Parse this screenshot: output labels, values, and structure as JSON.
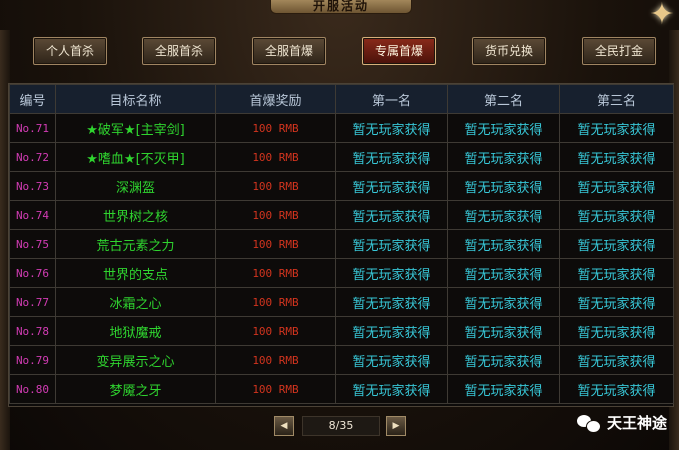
{
  "window_title": "开服活动",
  "tabs": [
    {
      "label": "个人首杀",
      "active": false
    },
    {
      "label": "全服首杀",
      "active": false
    },
    {
      "label": "全服首爆",
      "active": false
    },
    {
      "label": "专属首爆",
      "active": true
    },
    {
      "label": "货币兑换",
      "active": false
    },
    {
      "label": "全民打金",
      "active": false
    }
  ],
  "table": {
    "headers": [
      "编号",
      "目标名称",
      "首爆奖励",
      "第一名",
      "第二名",
      "第三名"
    ],
    "rows": [
      {
        "no": "No.71",
        "name": "★破军★[主宰剑]",
        "reward": "100 RMB",
        "first": "暂无玩家获得",
        "second": "暂无玩家获得",
        "third": "暂无玩家获得"
      },
      {
        "no": "No.72",
        "name": "★嗜血★[不灭甲]",
        "reward": "100 RMB",
        "first": "暂无玩家获得",
        "second": "暂无玩家获得",
        "third": "暂无玩家获得"
      },
      {
        "no": "No.73",
        "name": "深渊盔",
        "reward": "100 RMB",
        "first": "暂无玩家获得",
        "second": "暂无玩家获得",
        "third": "暂无玩家获得"
      },
      {
        "no": "No.74",
        "name": "世界树之核",
        "reward": "100 RMB",
        "first": "暂无玩家获得",
        "second": "暂无玩家获得",
        "third": "暂无玩家获得"
      },
      {
        "no": "No.75",
        "name": "荒古元素之力",
        "reward": "100 RMB",
        "first": "暂无玩家获得",
        "second": "暂无玩家获得",
        "third": "暂无玩家获得"
      },
      {
        "no": "No.76",
        "name": "世界的支点",
        "reward": "100 RMB",
        "first": "暂无玩家获得",
        "second": "暂无玩家获得",
        "third": "暂无玩家获得"
      },
      {
        "no": "No.77",
        "name": "冰霜之心",
        "reward": "100 RMB",
        "first": "暂无玩家获得",
        "second": "暂无玩家获得",
        "third": "暂无玩家获得"
      },
      {
        "no": "No.78",
        "name": "地狱魔戒",
        "reward": "100 RMB",
        "first": "暂无玩家获得",
        "second": "暂无玩家获得",
        "third": "暂无玩家获得"
      },
      {
        "no": "No.79",
        "name": "变异展示之心",
        "reward": "100 RMB",
        "first": "暂无玩家获得",
        "second": "暂无玩家获得",
        "third": "暂无玩家获得"
      },
      {
        "no": "No.80",
        "name": "梦魇之牙",
        "reward": "100 RMB",
        "first": "暂无玩家获得",
        "second": "暂无玩家获得",
        "third": "暂无玩家获得"
      }
    ]
  },
  "pager": {
    "text": "8/35",
    "prev_icon": "triangle-left-icon",
    "next_icon": "triangle-right-icon"
  },
  "watermark": {
    "text": "天王神途",
    "icon": "wechat-icon"
  },
  "colors": {
    "number": "#d23cb4",
    "target_name": "#2fd42f",
    "reward": "#d2341e",
    "rank_status": "#38c8d8",
    "header_bg": "#17202e",
    "active_tab": "#8a2a1a"
  }
}
